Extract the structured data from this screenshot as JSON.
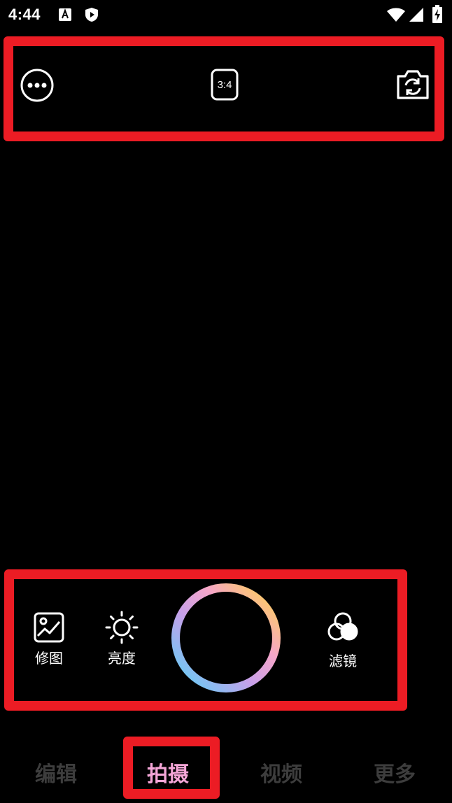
{
  "status_bar": {
    "time": "4:44"
  },
  "top_toolbar": {
    "more_icon": "more-dots-icon",
    "aspect_ratio": "3:4",
    "switch_camera_icon": "camera-switch-icon"
  },
  "controls": {
    "edit_photo_label": "修图",
    "brightness_label": "亮度",
    "filter_label": "滤镜"
  },
  "nav": {
    "tabs": [
      {
        "label": "编辑",
        "active": false
      },
      {
        "label": "拍摄",
        "active": true
      },
      {
        "label": "视频",
        "active": false
      },
      {
        "label": "更多",
        "active": false
      }
    ]
  },
  "colors": {
    "highlight_box": "#ec1c24",
    "active_tab": "#f4a6d7",
    "inactive_tab": "#3d3d3d"
  }
}
